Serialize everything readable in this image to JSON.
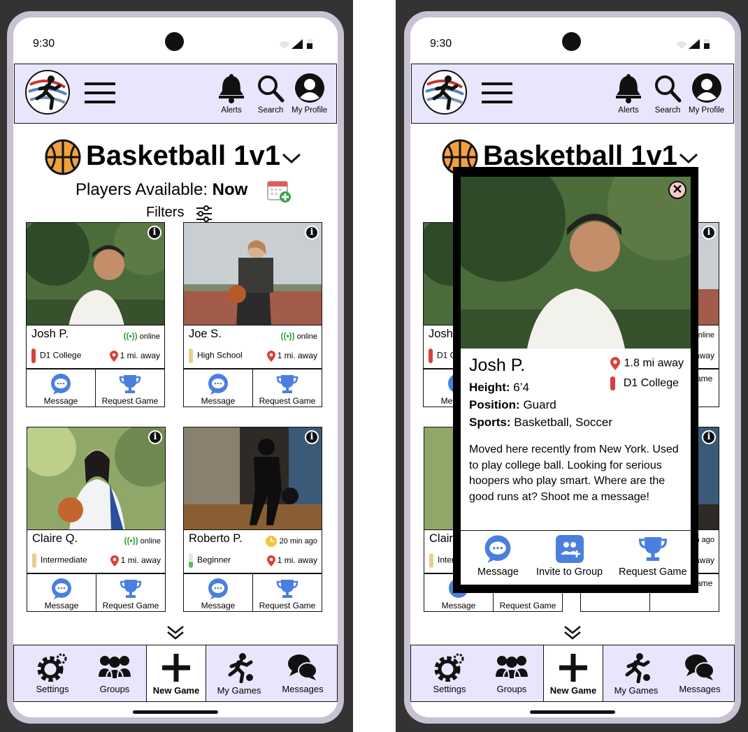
{
  "status": {
    "time": "9:30"
  },
  "topbar": {
    "alerts": "Alerts",
    "search": "Search",
    "profile": "My Profile"
  },
  "sport": {
    "title": "Basketball 1v1"
  },
  "availability": {
    "label": "Players Available:",
    "value": "Now"
  },
  "filters": {
    "label": "Filters"
  },
  "actions": {
    "message": "Message",
    "request": "Request Game",
    "invite": "Invite to Group"
  },
  "players": [
    {
      "name": "Josh P.",
      "status": "online",
      "status_type": "online",
      "level": "D1 College",
      "level_color": "#d9413a",
      "distance": "1 mi. away"
    },
    {
      "name": "Joe S.",
      "status": "online",
      "status_type": "online",
      "level": "High School",
      "level_color": "#e6cf8f",
      "distance": "1 mi. away"
    },
    {
      "name": "Claire Q.",
      "status": "online",
      "status_type": "online",
      "level": "Intermediate",
      "level_color": "#e6cf8f",
      "distance": "1 mi. away"
    },
    {
      "name": "Roberto P.",
      "status": "20 min ago",
      "status_type": "away",
      "level": "Beginner",
      "level_color": "#4fbf5a",
      "distance": "1 mi. away"
    }
  ],
  "nav": {
    "settings": "Settings",
    "groups": "Groups",
    "new_game": "New Game",
    "my_games": "My Games",
    "messages": "Messages"
  },
  "profile": {
    "name": "Josh P.",
    "distance": "1.8 mi away",
    "level": "D1 College",
    "height_label": "Height:",
    "height": "6’4",
    "position_label": "Position:",
    "position": "Guard",
    "sports_label": "Sports:",
    "sports": "Basketball, Soccer",
    "bio": "Moved here recently from New York. Used to play college ball. Looking for serious hoopers who play smart. Where are the good runs at? Shoot me a message!"
  },
  "colors": {
    "header_bg": "#e8e6fc",
    "frame": "#c9c0d3",
    "online": "#2e9e3a",
    "pin": "#d9413a",
    "action_blue": "#4a7fe0"
  }
}
